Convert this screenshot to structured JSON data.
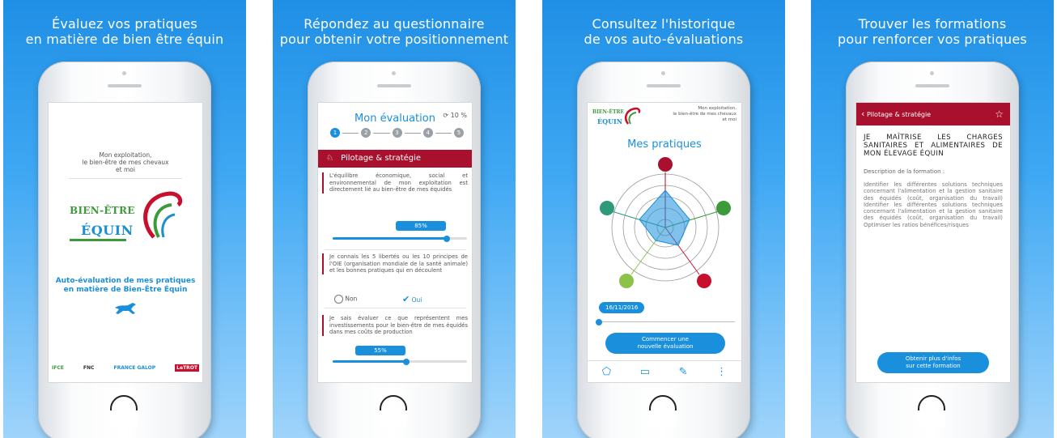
{
  "panels": [
    {
      "title_l1": "Évaluez vos pratiques",
      "title_l2": "en matière de bien être équin"
    },
    {
      "title_l1": "Répondez au questionnaire",
      "title_l2": "pour obtenir votre positionnement"
    },
    {
      "title_l1": "Consultez l'historique",
      "title_l2": "de vos auto-évaluations"
    },
    {
      "title_l1": "Trouver les formations",
      "title_l2": "pour renforcer vos pratiques"
    }
  ],
  "screen1": {
    "sub_l1": "Mon exploitation,",
    "sub_l2": "le bien-être de mes chevaux",
    "sub_l3": "et moi",
    "logo_be": "BIEN-ÊTRE",
    "logo_eq": "ÉQUIN",
    "auto_l1": "Auto-évaluation de mes pratiques",
    "auto_l2": "en matière de Bien-Être Équin",
    "partners": [
      "IFCE",
      "FNC",
      "FRANCE GALOP",
      "LeTROT"
    ]
  },
  "screen2": {
    "title": "Mon évaluation",
    "progress": "10 %",
    "steps": [
      "1",
      "2",
      "3",
      "4",
      "5"
    ],
    "section": "Pilotage & stratégie",
    "q1": "L'équilibre économique, social et environnemental de mon exploitation est directement lié au bien-être de mes équidés",
    "q1_value": "85%",
    "q2": "Je connais les 5 libertés ou les 10 principes de l'OIE (organisation mondiale de la santé animale) et les bonnes pratiques qui en découlent",
    "opt_no": "Non",
    "opt_yes": "Oui",
    "q3": "Je sais évaluer ce que représentent mes investissements pour le bien-être de mes équidés dans mes coûts de production",
    "q3_value": "55%"
  },
  "screen3": {
    "logo_be": "BIEN-ÊTRE",
    "logo_eq": "ÉQUIN",
    "sub_l1": "Mon exploitation,",
    "sub_l2": "le bien-être de mes chevaux",
    "sub_l3": "et moi",
    "title": "Mes pratiques",
    "date": "16/11/2016",
    "btn_l1": "Commencer une",
    "btn_l2": "nouvelle évaluation"
  },
  "screen4": {
    "back": "Pilotage & stratégie",
    "title": "JE MAÎTRISE LES CHARGES SANITAIRES ET ALIMENTAIRES DE MON ÉLEVAGE ÉQUIN",
    "desc_label": "Description de la formation :",
    "desc": "Identifier les différentes solutions techniques concernant l'alimentation et la gestion sanitaire des équidés (coût, organisation du travail) Identifier les différentes solutions techniques concernant l'alimentation et la gestion sanitaire des équidés (coût, organisation du travail) Optimiser les ratios bénéfices/risques",
    "btn_l1": "Obtenir plus d'infos",
    "btn_l2": "sur cette formation"
  },
  "colors": {
    "accent": "#1a8fdc",
    "brand_red": "#a8102d",
    "brand_green": "#3c9a3a"
  }
}
